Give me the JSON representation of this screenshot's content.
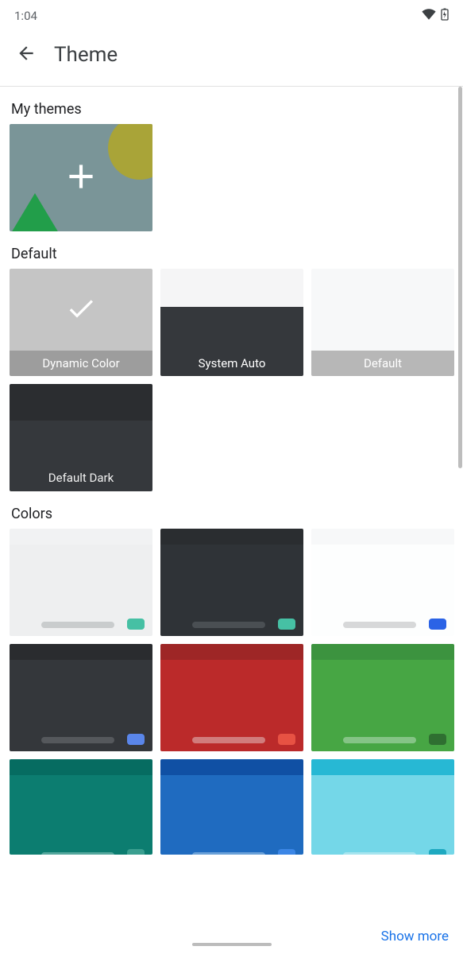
{
  "status": {
    "time": "1:04"
  },
  "header": {
    "title": "Theme"
  },
  "sections": {
    "my_themes_label": "My themes",
    "default_label": "Default",
    "colors_label": "Colors"
  },
  "default_tiles": {
    "dynamic": "Dynamic Color",
    "system_auto": "System Auto",
    "default": "Default",
    "default_dark": "Default Dark"
  },
  "colors": {
    "c0": {
      "top": "#f1f2f3",
      "body": "#eeeff0",
      "bar": "#c9cccd",
      "dot": "#46c0a4"
    },
    "c1": {
      "top": "#2a2d30",
      "body": "#2f3337",
      "bar": "#4a4f53",
      "dot": "#46c0a4"
    },
    "c2": {
      "top": "#f7f8f9",
      "body": "#fdfefe",
      "bar": "#d7d8d9",
      "dot": "#2b63e6"
    },
    "c3": {
      "top": "#2a2c2f",
      "body": "#34373b",
      "bar": "#55585c",
      "dot": "#5a86ea"
    },
    "c4": {
      "top": "#9e2626",
      "body": "#bb2a2a",
      "bar": "#d17c7c",
      "dot": "#e75243"
    },
    "c5": {
      "top": "#3c933f",
      "body": "#47a644",
      "bar": "#85c486",
      "dot": "#2f6f31"
    },
    "c6": {
      "top": "#066c61",
      "body": "#0c7d70",
      "bar": "#55a79d",
      "dot": "#3a9f90"
    },
    "c7": {
      "top": "#1050a4",
      "body": "#1f6bc0",
      "bar": "#6aa1d8",
      "dot": "#3b86e6"
    },
    "c8": {
      "top": "#27b8d4",
      "body": "#74d7e8",
      "bar": "#a7e5ef",
      "dot": "#1ea9c0"
    }
  },
  "footer": {
    "show_more": "Show more"
  }
}
